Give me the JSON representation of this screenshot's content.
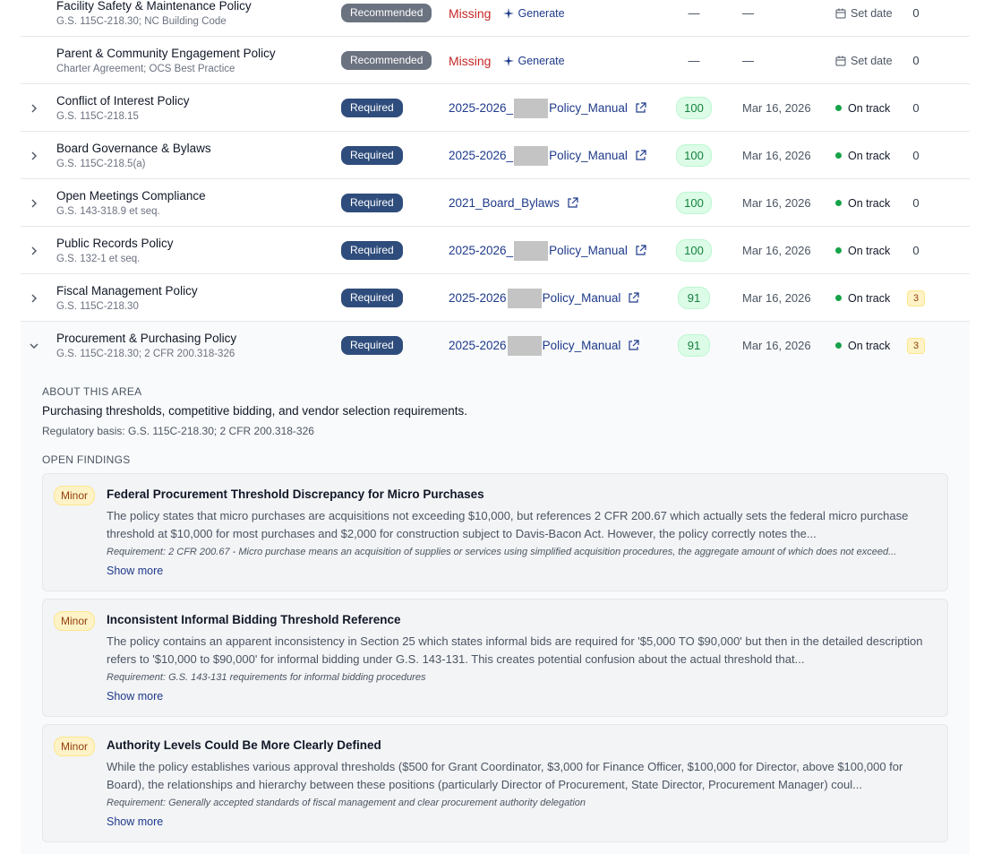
{
  "rows": [
    {
      "name": "Facility Safety & Maintenance Policy",
      "basis": "G.S. 115C-218.30; NC Building Code",
      "badge": "Recommended",
      "doc_status": "Missing",
      "generate": "Generate",
      "score": "—",
      "date": "—",
      "status": "Set date",
      "count": "0"
    },
    {
      "name": "Parent & Community Engagement Policy",
      "basis": "Charter Agreement; OCS Best Practice",
      "badge": "Recommended",
      "doc_status": "Missing",
      "generate": "Generate",
      "score": "—",
      "date": "—",
      "status": "Set date",
      "count": "0"
    },
    {
      "name": "Conflict of Interest Policy",
      "basis": "G.S. 115C-218.15",
      "badge": "Required",
      "doc_a": "2025-2026_",
      "doc_b": "Policy_Manual",
      "score": "100",
      "date": "Mar 16, 2026",
      "status": "On track",
      "count": "0"
    },
    {
      "name": "Board Governance & Bylaws",
      "basis": "G.S. 115C-218.5(a)",
      "badge": "Required",
      "doc_a": "2025-2026_",
      "doc_b": "Policy_Manual",
      "score": "100",
      "date": "Mar 16, 2026",
      "status": "On track",
      "count": "0"
    },
    {
      "name": "Open Meetings Compliance",
      "basis": "G.S. 143-318.9 et seq.",
      "badge": "Required",
      "doc_full": "2021_Board_Bylaws",
      "score": "100",
      "date": "Mar 16, 2026",
      "status": "On track",
      "count": "0"
    },
    {
      "name": "Public Records Policy",
      "basis": "G.S. 132-1 et seq.",
      "badge": "Required",
      "doc_a": "2025-2026_",
      "doc_b": "Policy_Manual",
      "score": "100",
      "date": "Mar 16, 2026",
      "status": "On track",
      "count": "0"
    },
    {
      "name": "Fiscal Management Policy",
      "basis": "G.S. 115C-218.30",
      "badge": "Required",
      "doc_a": "2025-2026",
      "doc_b": "Policy_Manual",
      "score": "91",
      "date": "Mar 16, 2026",
      "status": "On track",
      "count": "3"
    },
    {
      "name": "Procurement & Purchasing Policy",
      "basis": "G.S. 115C-218.30; 2 CFR 200.318-326",
      "badge": "Required",
      "doc_a": "2025-2026",
      "doc_b": "Policy_Manual",
      "score": "91",
      "date": "Mar 16, 2026",
      "status": "On track",
      "count": "3"
    }
  ],
  "detail": {
    "about_label": "ABOUT THIS AREA",
    "description": "Purchasing thresholds, competitive bidding, and vendor selection requirements.",
    "regulatory_basis": "Regulatory basis: G.S. 115C-218.30; 2 CFR 200.318-326",
    "findings_label": "OPEN FINDINGS",
    "findings": [
      {
        "severity": "Minor",
        "title": "Federal Procurement Threshold Discrepancy for Micro Purchases",
        "body": "The policy states that micro purchases are acquisitions not exceeding $10,000, but references 2 CFR 200.67 which actually sets the federal micro purchase threshold at $10,000 for most purchases and $2,000 for construction subject to Davis-Bacon Act. However, the policy correctly notes the...",
        "requirement": "Requirement: 2 CFR 200.67 - Micro purchase means an acquisition of supplies or services using simplified acquisition procedures, the aggregate amount of which does not exceed...",
        "show_more": "Show more"
      },
      {
        "severity": "Minor",
        "title": "Inconsistent Informal Bidding Threshold Reference",
        "body": "The policy contains an apparent inconsistency in Section 25 which states informal bids are required for '$5,000 TO $90,000' but then in the detailed description refers to '$10,000 to $90,000' for informal bidding under G.S. 143-131. This creates potential confusion about the actual threshold that...",
        "requirement": "Requirement: G.S. 143-131 requirements for informal bidding procedures",
        "show_more": "Show more"
      },
      {
        "severity": "Minor",
        "title": "Authority Levels Could Be More Clearly Defined",
        "body": "While the policy establishes various approval thresholds ($500 for Grant Coordinator, $3,000 for Finance Officer, $100,000 for Director, above $100,000 for Board), the relationships and hierarchy between these positions (particularly Director of Procurement, State Director, Procurement Manager) coul...",
        "requirement": "Requirement: Generally accepted standards of fiscal management and clear procurement authority delegation",
        "show_more": "Show more"
      }
    ]
  },
  "colors": {
    "required": "#2f4d7c",
    "recommended": "#6b7280",
    "missing": "#c62828",
    "score_bg": "#dcfce7",
    "on_track": "#16a34a"
  }
}
